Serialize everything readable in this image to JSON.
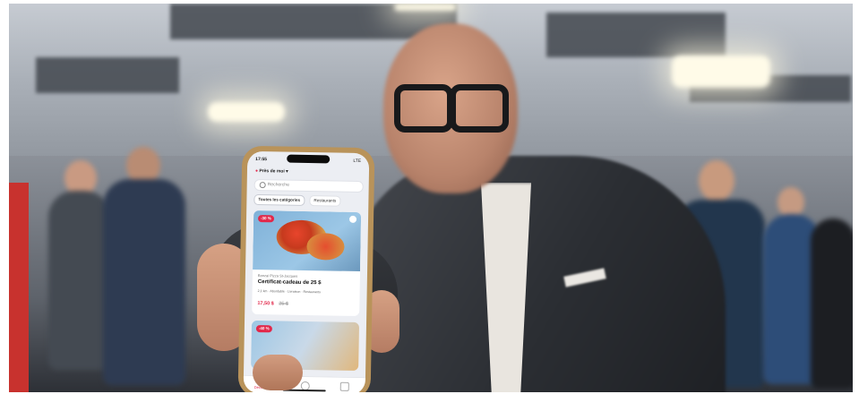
{
  "scene": {
    "description_colors": {
      "accent": "#e2284a",
      "phone_frame": "#b9935a",
      "jacket": "#2b2e33"
    }
  },
  "app": {
    "status_time": "17:55",
    "status_signal": "LTE",
    "location": "Près de moi",
    "search_placeholder": "Recherche",
    "chips": [
      "Toutes les catégories",
      "Restaurants"
    ],
    "card": {
      "badge": "-30 %",
      "shop": "Bonzai Pizza St-Jacques",
      "title": "Certificat-cadeau de 25 $",
      "tags": "2,1 km · Abordable · Livraison · Restaurants",
      "price": "17,50 $",
      "old_price": "25 $"
    },
    "card2_badge": "-40 %",
    "tab_home_label": "Découvrir"
  }
}
